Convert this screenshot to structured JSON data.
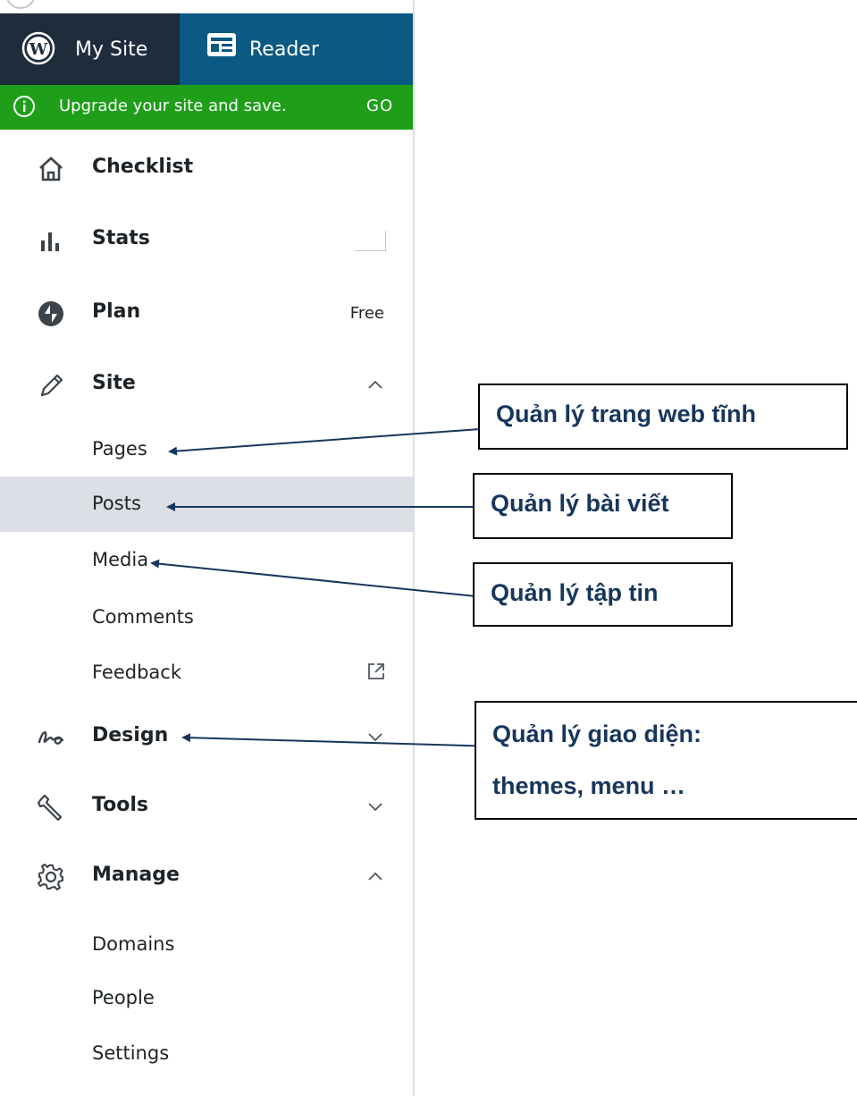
{
  "masterbar": {
    "my_site_label": "My Site",
    "reader_label": "Reader",
    "colors": {
      "my_site_bg": "#1e2c3c",
      "reader_bg": "#0b5a83"
    }
  },
  "notice": {
    "text": "Upgrade your site and save.",
    "action": "GO",
    "icon": "info-icon",
    "color": "#1f9e1a"
  },
  "menu": {
    "checklist": {
      "label": "Checklist",
      "icon": "home-icon"
    },
    "stats": {
      "label": "Stats",
      "icon": "bar-chart-icon"
    },
    "plan": {
      "label": "Plan",
      "badge": "Free",
      "icon": "jetpack-bolt-icon"
    },
    "site": {
      "label": "Site",
      "icon": "pencil-icon",
      "expanded": true,
      "children": {
        "pages": "Pages",
        "posts": "Posts",
        "media": "Media",
        "comments": "Comments",
        "feedback": "Feedback"
      }
    },
    "design": {
      "label": "Design",
      "icon": "design-squiggle-icon",
      "expanded": false
    },
    "tools": {
      "label": "Tools",
      "icon": "wrench-icon",
      "expanded": false
    },
    "manage": {
      "label": "Manage",
      "icon": "gear-icon",
      "expanded": true,
      "children": {
        "domains": "Domains",
        "people": "People",
        "settings": "Settings"
      }
    },
    "selected": "posts",
    "selected_color": "#dcdfe5"
  },
  "annotations": {
    "pages": "Quản lý trang web tĩnh",
    "posts": "Quản lý bài viết",
    "media": "Quản lý tập tin",
    "design_line1": "Quản lý giao diện:",
    "design_line2": "themes, menu …",
    "color": "#17365d"
  }
}
